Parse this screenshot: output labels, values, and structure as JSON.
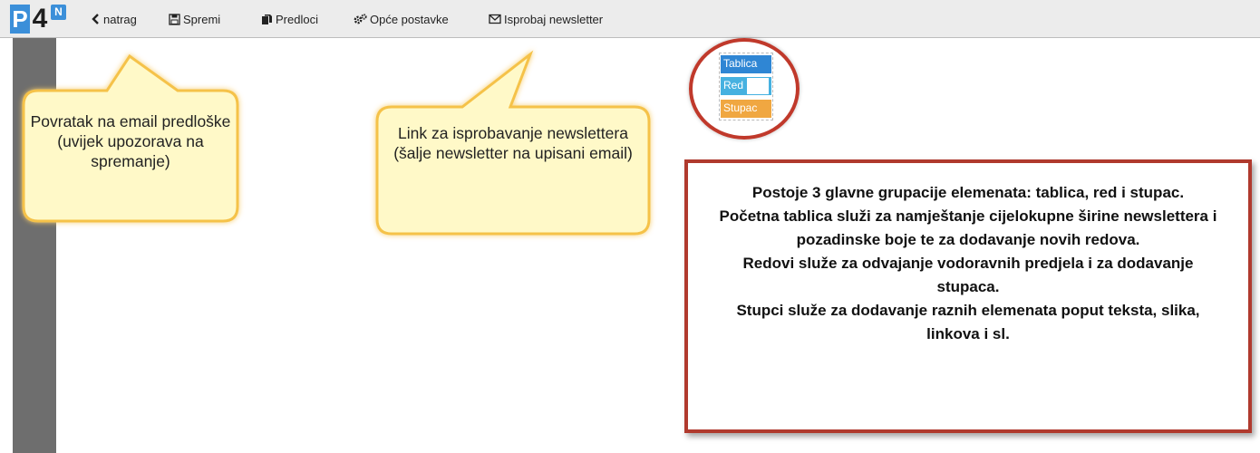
{
  "toolbar": {
    "logo_p": "P",
    "logo_4": "4",
    "logo_n": "N",
    "back_label": "natrag",
    "save_label": "Spremi",
    "templates_label": "Predloci",
    "settings_label": "Opće postavke",
    "test_label": "Isprobaj newsletter"
  },
  "elements": {
    "tablica": "Tablica",
    "red": "Red",
    "stupac": "Stupac"
  },
  "callouts": {
    "back": "Povratak na email predloške (uvijek upozorava na spremanje)",
    "test": "Link za isprobavanje newslettera (šalje newsletter na upisani email)"
  },
  "info": {
    "line1": "Postoje 3 glavne grupacije elemenata: tablica, red i stupac.",
    "line2": "Početna tablica služi za namještanje cijelokupne širine newslettera i pozadinske boje te za dodavanje novih redova.",
    "line3": "Redovi služe za odvajanje vodoravnih predjela i za dodavanje stupaca.",
    "line4": "Stupci služe za dodavanje raznih elemenata poput teksta, slika, linkova i sl."
  },
  "colors": {
    "tablica": "#2f86d4",
    "red": "#46b1e0",
    "stupac": "#f0a741",
    "annotation_border": "#b03a2e",
    "callout_fill": "#fff9c8",
    "callout_border": "#f5c24a"
  },
  "icons": [
    "chevron-left-icon",
    "save-icon",
    "templates-icon",
    "gears-icon",
    "envelope-icon"
  ]
}
